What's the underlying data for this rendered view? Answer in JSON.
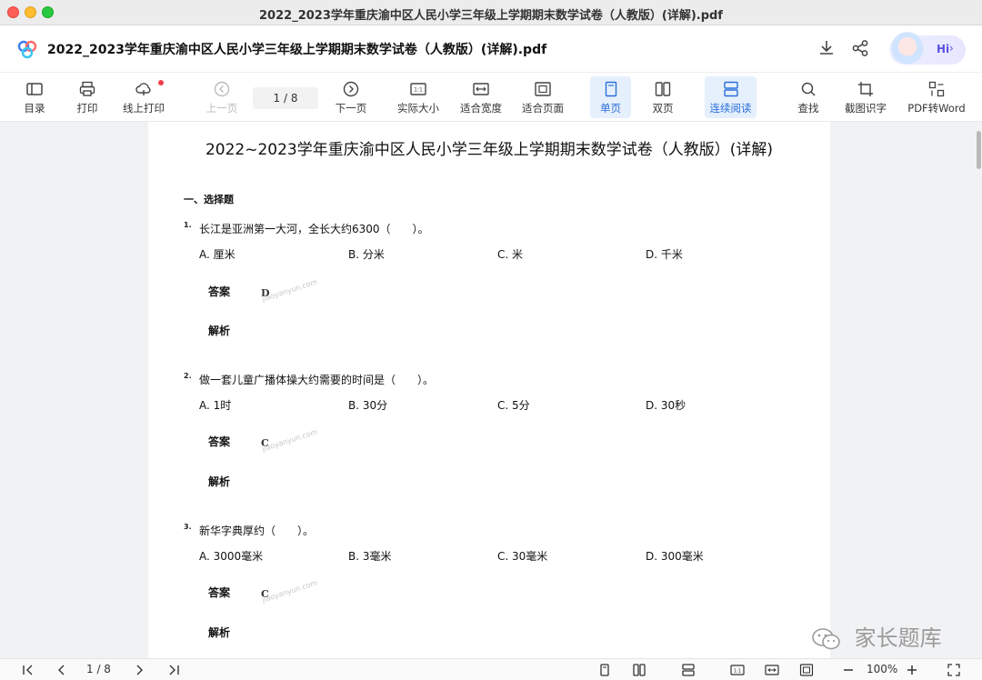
{
  "window": {
    "title": "2022_2023学年重庆渝中区人民小学三年级上学期期末数学试卷（人教版）(详解).pdf"
  },
  "header": {
    "doc_title": "2022_2023学年重庆渝中区人民小学三年级上学期期末数学试卷（人教版）(详解).pdf",
    "hi_label": "Hi",
    "icons": [
      "download-icon",
      "share-icon",
      "assistant-avatar-icon"
    ]
  },
  "toolbar": {
    "catalog": "目录",
    "print": "打印",
    "online_print": "线上打印",
    "prev_page": "上一页",
    "page_indicator": "1  /  8",
    "next_page": "下一页",
    "actual_size": "实际大小",
    "fit_width": "适合宽度",
    "fit_page": "适合页面",
    "single_page": "单页",
    "double_page": "双页",
    "continuous": "连续阅读",
    "find": "查找",
    "ocr": "截图识字",
    "pdf_to_word": "PDF转Word"
  },
  "document": {
    "title": "2022~2023学年重庆渝中区人民小学三年级上学期期末数学试卷（人教版）(详解)",
    "section": "一、选择题",
    "answer_label": "答案",
    "analysis_label": "解析",
    "watermark": "jiaoyanyun.com",
    "questions": [
      {
        "num": "1.",
        "text": "长江是亚洲第一大河，全长大约6300（　　）。",
        "options": [
          "A. 厘米",
          "B. 分米",
          "C. 米",
          "D. 千米"
        ],
        "answer": "D"
      },
      {
        "num": "2.",
        "text": "做一套儿童广播体操大约需要的时间是（　　）。",
        "options": [
          "A. 1时",
          "B. 30分",
          "C. 5分",
          "D. 30秒"
        ],
        "answer": "C"
      },
      {
        "num": "3.",
        "text": "新华字典厚约（　　）。",
        "options": [
          "A. 3000毫米",
          "B. 3毫米",
          "C. 30毫米",
          "D. 300毫米"
        ],
        "answer": "C"
      }
    ]
  },
  "brand_watermark": "家长题库",
  "bottom_bar": {
    "page_indicator": "1  /  8",
    "zoom_level": "100%"
  },
  "colors": {
    "accent": "#2a6fd8",
    "active_bg": "#e6f0fd",
    "notify_dot": "#ef3e4a"
  }
}
